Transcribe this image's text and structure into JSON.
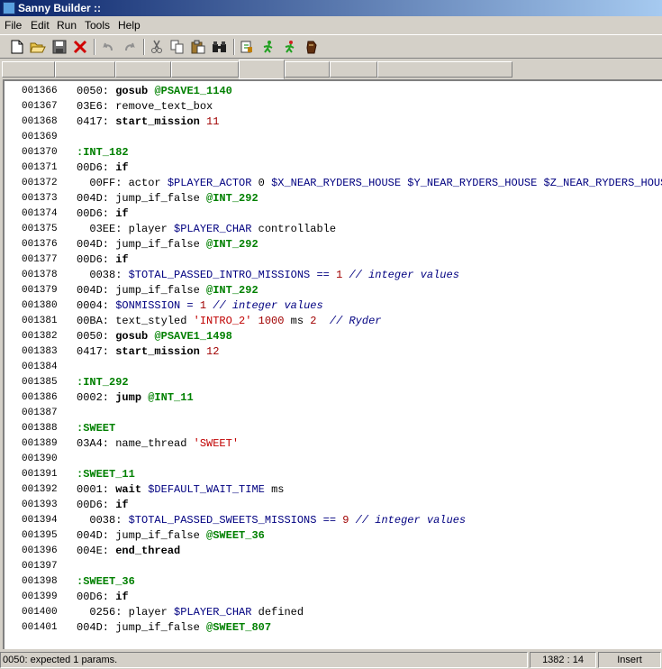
{
  "window": {
    "title": "Sanny Builder ::"
  },
  "menu": [
    "File",
    "Edit",
    "Run",
    "Tools",
    "Help"
  ],
  "toolbar": [
    "new-icon",
    "open-icon",
    "save-icon",
    "close-icon",
    "undo-icon",
    "redo-icon",
    "cut-icon",
    "copy-icon",
    "paste-icon",
    "find-icon",
    "compile-icon",
    "run-icon",
    "compile-run-icon",
    "game-icon"
  ],
  "tabs": [
    "",
    "",
    "",
    "",
    "",
    "",
    "",
    ""
  ],
  "editor": {
    "lines": [
      {
        "n": "001366",
        "code": [
          {
            "t": "0050: ",
            "c": "op"
          },
          {
            "t": "gosub ",
            "c": "kw"
          },
          {
            "t": "@PSAVE1_1140",
            "c": "lbl"
          }
        ]
      },
      {
        "n": "001367",
        "code": [
          {
            "t": "03E6: remove_text_box",
            "c": "op"
          }
        ]
      },
      {
        "n": "001368",
        "code": [
          {
            "t": "0417: ",
            "c": "op"
          },
          {
            "t": "start_mission ",
            "c": "kw"
          },
          {
            "t": "11",
            "c": "num"
          }
        ]
      },
      {
        "n": "001369",
        "code": []
      },
      {
        "n": "001370",
        "code": [
          {
            "t": ":INT_182",
            "c": "lbl"
          }
        ]
      },
      {
        "n": "001371",
        "code": [
          {
            "t": "00D6: ",
            "c": "op"
          },
          {
            "t": "if",
            "c": "kw"
          }
        ]
      },
      {
        "n": "001372",
        "code": [
          {
            "t": "  00FF: actor ",
            "c": "op"
          },
          {
            "t": "$PLAYER_ACTOR ",
            "c": "var"
          },
          {
            "t": "0 ",
            "c": "op"
          },
          {
            "t": "$X_NEAR_RYDERS_HOUSE $Y_NEAR_RYDERS_HOUSE $Z_NEAR_RYDERS_HOUSE",
            "c": "var"
          }
        ]
      },
      {
        "n": "001373",
        "code": [
          {
            "t": "004D: jump_if_false ",
            "c": "op"
          },
          {
            "t": "@INT_292",
            "c": "lbl"
          }
        ]
      },
      {
        "n": "001374",
        "code": [
          {
            "t": "00D6: ",
            "c": "op"
          },
          {
            "t": "if",
            "c": "kw"
          }
        ]
      },
      {
        "n": "001375",
        "code": [
          {
            "t": "  03EE: player ",
            "c": "op"
          },
          {
            "t": "$PLAYER_CHAR ",
            "c": "var"
          },
          {
            "t": "controllable",
            "c": "op"
          }
        ]
      },
      {
        "n": "001376",
        "code": [
          {
            "t": "004D: jump_if_false ",
            "c": "op"
          },
          {
            "t": "@INT_292",
            "c": "lbl"
          }
        ]
      },
      {
        "n": "001377",
        "code": [
          {
            "t": "00D6: ",
            "c": "op"
          },
          {
            "t": "if",
            "c": "kw"
          }
        ]
      },
      {
        "n": "001378",
        "code": [
          {
            "t": "  0038: ",
            "c": "op"
          },
          {
            "t": "$TOTAL_PASSED_INTRO_MISSIONS",
            "c": "var"
          },
          {
            "t": " == ",
            "c": "var"
          },
          {
            "t": "1 ",
            "c": "num"
          },
          {
            "t": "// integer values",
            "c": "cmt"
          }
        ]
      },
      {
        "n": "001379",
        "code": [
          {
            "t": "004D: jump_if_false ",
            "c": "op"
          },
          {
            "t": "@INT_292",
            "c": "lbl"
          }
        ]
      },
      {
        "n": "001380",
        "code": [
          {
            "t": "0004: ",
            "c": "op"
          },
          {
            "t": "$ONMISSION",
            "c": "var"
          },
          {
            "t": " = ",
            "c": "var"
          },
          {
            "t": "1 ",
            "c": "num"
          },
          {
            "t": "// integer values",
            "c": "cmt"
          }
        ]
      },
      {
        "n": "001381",
        "code": [
          {
            "t": "00BA: text_styled ",
            "c": "op"
          },
          {
            "t": "'INTRO_2' ",
            "c": "str"
          },
          {
            "t": "1000 ",
            "c": "num"
          },
          {
            "t": "ms ",
            "c": "op"
          },
          {
            "t": "2  ",
            "c": "num"
          },
          {
            "t": "// Ryder",
            "c": "cmt"
          }
        ]
      },
      {
        "n": "001382",
        "code": [
          {
            "t": "0050: ",
            "c": "op"
          },
          {
            "t": "gosub ",
            "c": "kw"
          },
          {
            "t": "@PSAVE1_1498",
            "c": "lbl"
          }
        ]
      },
      {
        "n": "001383",
        "code": [
          {
            "t": "0417: ",
            "c": "op"
          },
          {
            "t": "start_mission ",
            "c": "kw"
          },
          {
            "t": "12",
            "c": "num"
          }
        ]
      },
      {
        "n": "001384",
        "code": []
      },
      {
        "n": "001385",
        "code": [
          {
            "t": ":INT_292",
            "c": "lbl"
          }
        ]
      },
      {
        "n": "001386",
        "code": [
          {
            "t": "0002: ",
            "c": "op"
          },
          {
            "t": "jump ",
            "c": "kw"
          },
          {
            "t": "@INT_11",
            "c": "lbl"
          }
        ]
      },
      {
        "n": "001387",
        "code": []
      },
      {
        "n": "001388",
        "code": [
          {
            "t": ":SWEET",
            "c": "lbl"
          }
        ]
      },
      {
        "n": "001389",
        "code": [
          {
            "t": "03A4: name_thread ",
            "c": "op"
          },
          {
            "t": "'SWEET'",
            "c": "str"
          }
        ]
      },
      {
        "n": "001390",
        "code": []
      },
      {
        "n": "001391",
        "code": [
          {
            "t": ":SWEET_11",
            "c": "lbl"
          }
        ]
      },
      {
        "n": "001392",
        "code": [
          {
            "t": "0001: ",
            "c": "op"
          },
          {
            "t": "wait ",
            "c": "kw"
          },
          {
            "t": "$DEFAULT_WAIT_TIME ",
            "c": "var"
          },
          {
            "t": "ms",
            "c": "op"
          }
        ]
      },
      {
        "n": "001393",
        "code": [
          {
            "t": "00D6: ",
            "c": "op"
          },
          {
            "t": "if",
            "c": "kw"
          }
        ]
      },
      {
        "n": "001394",
        "code": [
          {
            "t": "  0038: ",
            "c": "op"
          },
          {
            "t": "$TOTAL_PASSED_SWEETS_MISSIONS",
            "c": "var"
          },
          {
            "t": " == ",
            "c": "var"
          },
          {
            "t": "9 ",
            "c": "num"
          },
          {
            "t": "// integer values",
            "c": "cmt"
          }
        ]
      },
      {
        "n": "001395",
        "code": [
          {
            "t": "004D: jump_if_false ",
            "c": "op"
          },
          {
            "t": "@SWEET_36",
            "c": "lbl"
          }
        ]
      },
      {
        "n": "001396",
        "code": [
          {
            "t": "004E: ",
            "c": "op"
          },
          {
            "t": "end_thread",
            "c": "kw"
          }
        ]
      },
      {
        "n": "001397",
        "code": []
      },
      {
        "n": "001398",
        "code": [
          {
            "t": ":SWEET_36",
            "c": "lbl"
          }
        ]
      },
      {
        "n": "001399",
        "code": [
          {
            "t": "00D6: ",
            "c": "op"
          },
          {
            "t": "if",
            "c": "kw"
          }
        ]
      },
      {
        "n": "001400",
        "code": [
          {
            "t": "  0256: player ",
            "c": "op"
          },
          {
            "t": "$PLAYER_CHAR ",
            "c": "var"
          },
          {
            "t": "defined",
            "c": "op"
          }
        ]
      },
      {
        "n": "001401",
        "code": [
          {
            "t": "004D: jump_if_false ",
            "c": "op"
          },
          {
            "t": "@SWEET_807",
            "c": "lbl"
          }
        ]
      }
    ]
  },
  "statusbar": {
    "message": "0050: expected 1 params.",
    "position": "1382 :  14",
    "mode": "Insert"
  }
}
